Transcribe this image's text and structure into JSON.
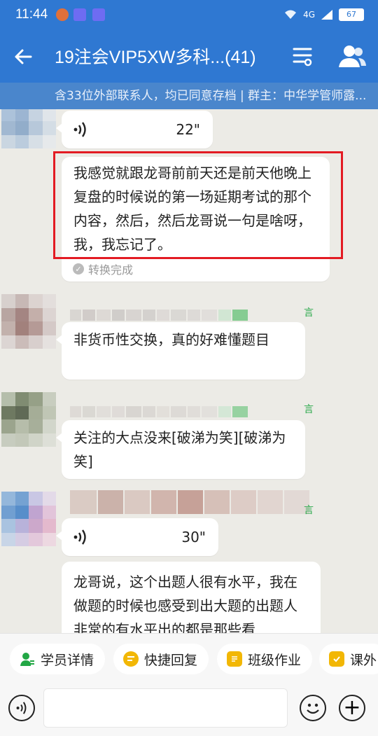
{
  "status_bar": {
    "time": "11:44",
    "network": "4G",
    "battery": "67"
  },
  "header": {
    "title": "19注会VIP5XW多科...(41)",
    "notice": "含33位外部联系人，均已同意存档 | 群主：中华学管师露..."
  },
  "messages": [
    {
      "type": "voice",
      "duration": "22\""
    },
    {
      "type": "text",
      "text": "我感觉就跟龙哥前前天还是前天他晚上复盘的时候说的第一场延期考试的那个内容，然后，然后龙哥说一句是啥呀，我，我忘记了。",
      "status": "转换完成",
      "highlighted": true
    },
    {
      "type": "text",
      "text": "非货币性交换，真的好难懂题目"
    },
    {
      "type": "text",
      "text": "关注的大点没来[破涕为笑][破涕为笑]"
    },
    {
      "type": "voice",
      "duration": "30\""
    },
    {
      "type": "text",
      "text": "龙哥说，这个出题人很有水平，我在做题的时候也感受到出大题的出题人非常的有水平出的都是那些看"
    }
  ],
  "quick_tabs": [
    {
      "label": "学员详情",
      "icon": "student-detail-icon",
      "color": "#22a745"
    },
    {
      "label": "快捷回复",
      "icon": "quick-reply-icon",
      "color": "#f2b705"
    },
    {
      "label": "班级作业",
      "icon": "class-homework-icon",
      "color": "#f2b705"
    },
    {
      "label": "课外",
      "icon": "extracurricular-icon",
      "color": "#f2b705"
    }
  ],
  "colors": {
    "header_bg": "#2f78d2",
    "notice_bg": "#4a86cc",
    "highlight": "#e31b23",
    "chat_bg": "#ecebe6"
  }
}
